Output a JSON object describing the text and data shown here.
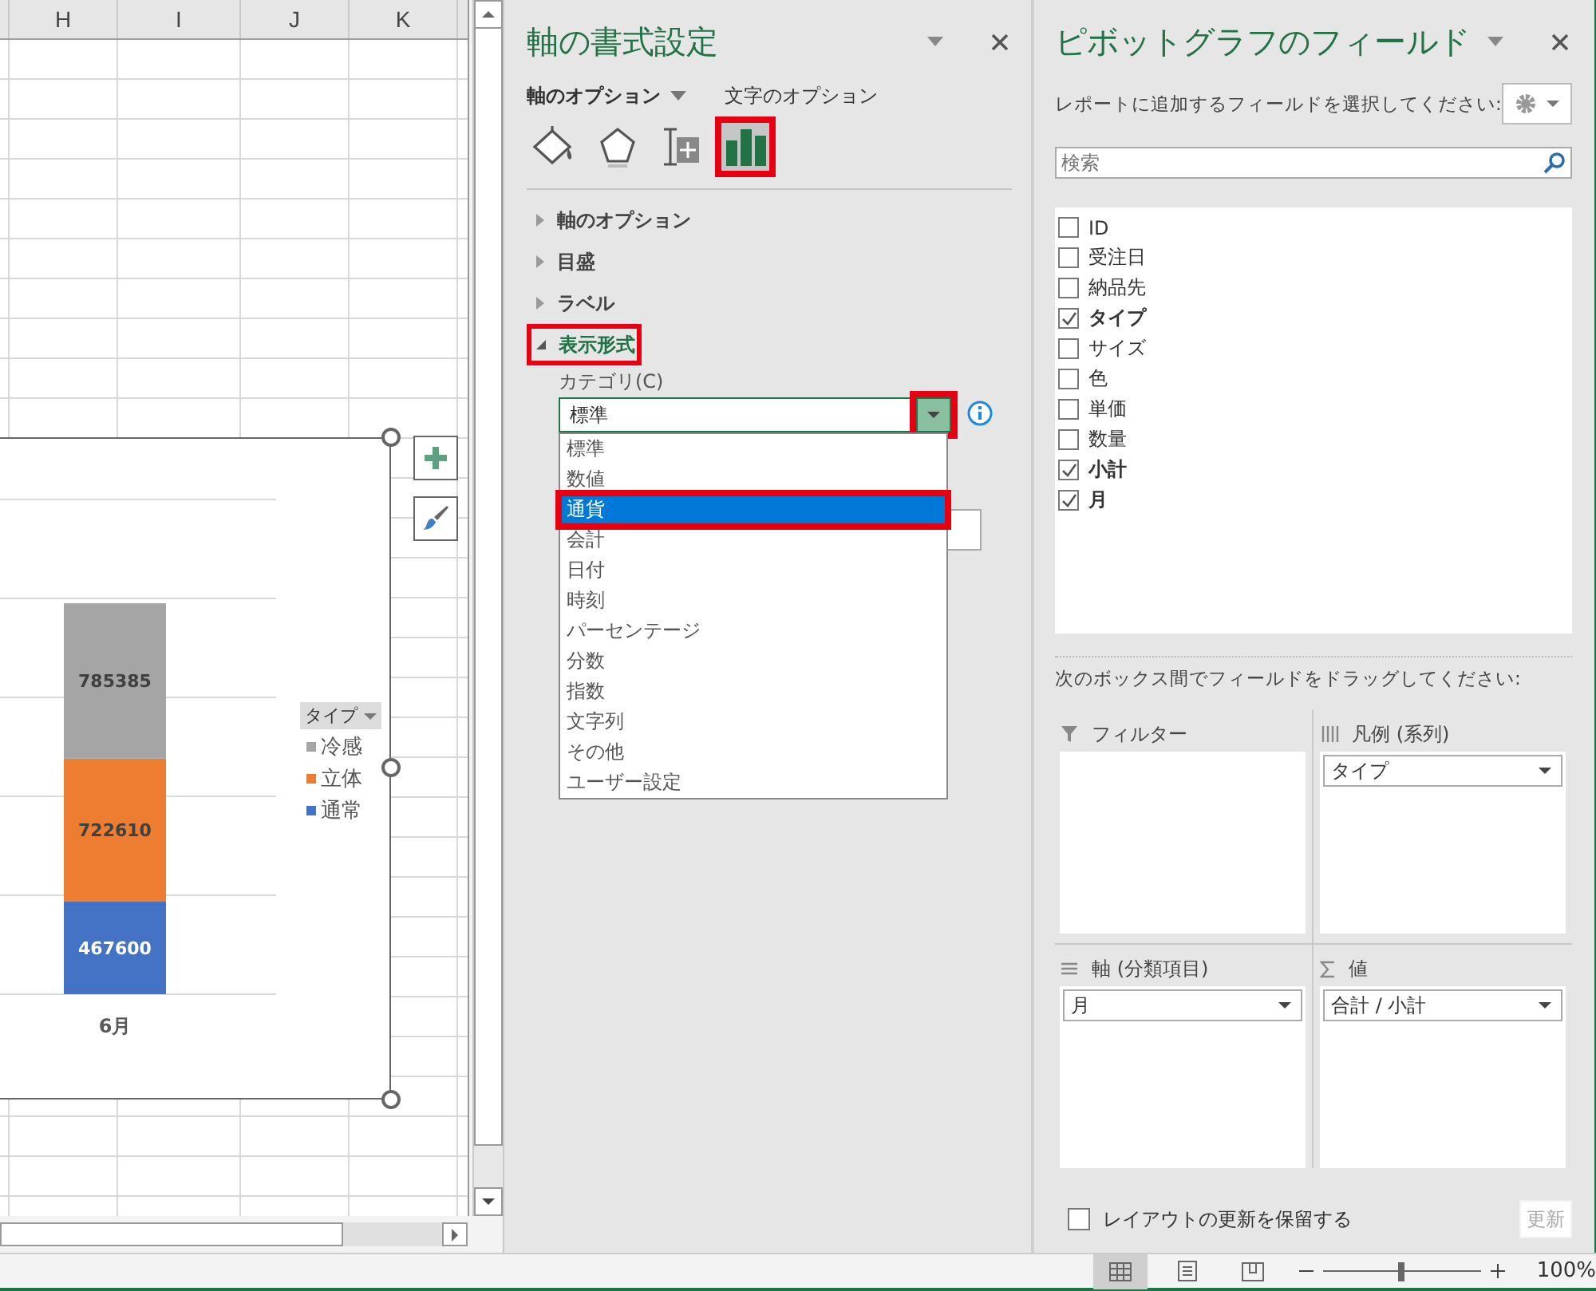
{
  "sheet": {
    "columns": [
      "H",
      "I",
      "J",
      "K"
    ],
    "chart": {
      "legend_button": "タイプ",
      "chart_data": {
        "type": "bar",
        "stacked": true,
        "categories": [
          "6月"
        ],
        "ylim": [
          0,
          2500000
        ],
        "data_labels": true,
        "legend": true,
        "series": [
          {
            "name": "通常",
            "color": "#4472c4",
            "values": [
              467600
            ]
          },
          {
            "name": "立体",
            "color": "#ed7d31",
            "values": [
              722610
            ]
          },
          {
            "name": "冷感",
            "color": "#a5a5a5",
            "values": [
              785385
            ]
          }
        ]
      }
    }
  },
  "format_pane": {
    "title": "軸の書式設定",
    "tabs": [
      {
        "label": "軸のオプション",
        "selected": true
      },
      {
        "label": "文字のオプション",
        "selected": false
      }
    ],
    "icon_tabs": [
      {
        "kind": "fill",
        "selected": false,
        "highlighted": false
      },
      {
        "kind": "effects",
        "selected": false,
        "highlighted": false
      },
      {
        "kind": "size",
        "selected": false,
        "highlighted": false
      },
      {
        "kind": "axis",
        "selected": true,
        "highlighted": true
      }
    ],
    "sections": [
      {
        "label": "軸のオプション",
        "expanded": false,
        "highlighted": false
      },
      {
        "label": "目盛",
        "expanded": false,
        "highlighted": false
      },
      {
        "label": "ラベル",
        "expanded": false,
        "highlighted": false
      },
      {
        "label": "表示形式",
        "expanded": true,
        "highlighted": true
      }
    ],
    "category_label": "カテゴリ(C)",
    "category_select": {
      "value": "標準",
      "button_highlighted": true
    },
    "options": [
      {
        "label": "標準",
        "selected": false,
        "highlighted": false
      },
      {
        "label": "数値",
        "selected": false,
        "highlighted": false
      },
      {
        "label": "通貨",
        "selected": true,
        "highlighted": true
      },
      {
        "label": "会計",
        "selected": false,
        "highlighted": false
      },
      {
        "label": "日付",
        "selected": false,
        "highlighted": false
      },
      {
        "label": "時刻",
        "selected": false,
        "highlighted": false
      },
      {
        "label": "パーセンテージ",
        "selected": false,
        "highlighted": false
      },
      {
        "label": "分数",
        "selected": false,
        "highlighted": false
      },
      {
        "label": "指数",
        "selected": false,
        "highlighted": false
      },
      {
        "label": "文字列",
        "selected": false,
        "highlighted": false
      },
      {
        "label": "その他",
        "selected": false,
        "highlighted": false
      },
      {
        "label": "ユーザー設定",
        "selected": false,
        "highlighted": false
      }
    ]
  },
  "pivot_pane": {
    "title": "ピボットグラフのフィールド",
    "instruction": "レポートに追加するフィールドを選択してください:",
    "search": {
      "placeholder": "検索"
    },
    "fields": [
      {
        "label": "ID",
        "checked": false
      },
      {
        "label": "受注日",
        "checked": false
      },
      {
        "label": "納品先",
        "checked": false
      },
      {
        "label": "タイプ",
        "checked": true
      },
      {
        "label": "サイズ",
        "checked": false
      },
      {
        "label": "色",
        "checked": false
      },
      {
        "label": "単価",
        "checked": false
      },
      {
        "label": "数量",
        "checked": false
      },
      {
        "label": "小計",
        "checked": true
      },
      {
        "label": "月",
        "checked": true
      }
    ],
    "areas_hint": "次のボックス間でフィールドをドラッグしてください:",
    "areas": [
      {
        "kind": "filter",
        "label": "フィルター"
      },
      {
        "kind": "legend",
        "label": "凡例 (系列)",
        "items": [
          "タイプ"
        ]
      },
      {
        "kind": "axis",
        "label": "軸 (分類項目)",
        "items": [
          "月"
        ]
      },
      {
        "kind": "values",
        "label": "値",
        "items": [
          "合計 / 小計"
        ]
      }
    ],
    "defer_update": {
      "label": "レイアウトの更新を保留する",
      "checked": false
    },
    "update_button": {
      "label": "更新",
      "disabled": true
    }
  },
  "status_bar": {
    "views": [
      {
        "kind": "normal",
        "selected": true
      },
      {
        "kind": "page_layout",
        "selected": false
      },
      {
        "kind": "page_break",
        "selected": false
      }
    ],
    "zoom": {
      "level": 0.5,
      "reading": "100%"
    }
  }
}
